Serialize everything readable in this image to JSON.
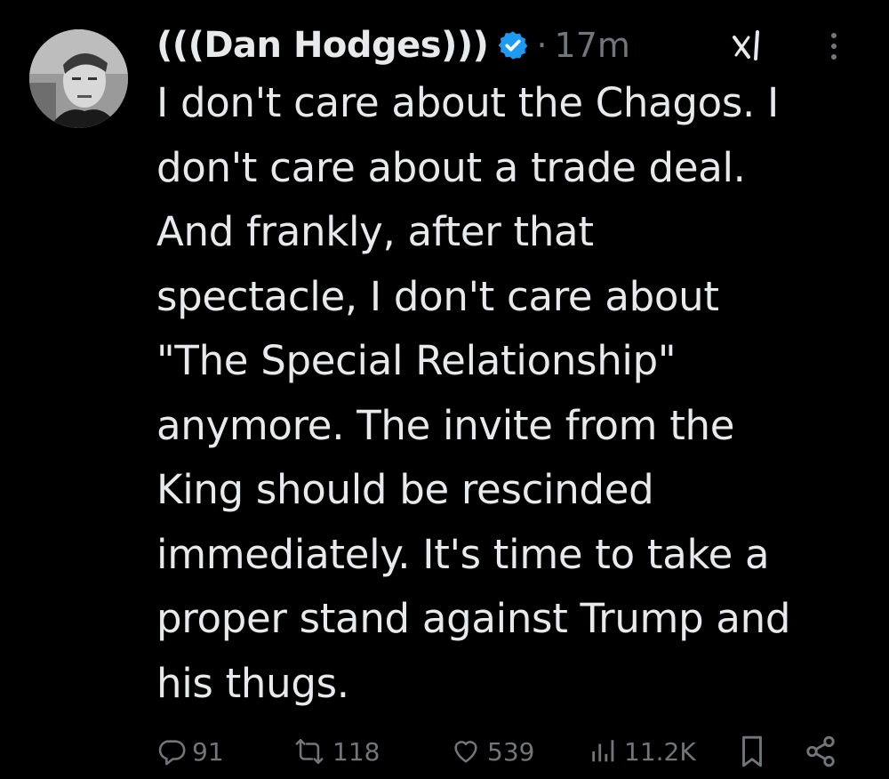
{
  "tweet": {
    "author_name": "(((Dan Hodges)))",
    "verified": true,
    "separator": "·",
    "time": "17m",
    "text": "I don't care about the Chagos. I\ndon't care about a trade deal.\nAnd frankly, after that\nspectacle, I don't care about\n\"The Special Relationship\"\nanymore. The invite from the\nKing should be rescinded\nimmediately. It's time to take a\nproper stand against Trump and\nhis thugs."
  },
  "actions": {
    "replies": "91",
    "retweets": "118",
    "likes": "539",
    "views": "11.2K"
  },
  "icons": {
    "avatar": "avatar-photo",
    "verified": "verified-badge-icon",
    "grok": "grok-icon",
    "more": "more-options-icon",
    "reply": "reply-icon",
    "retweet": "retweet-icon",
    "like": "heart-icon",
    "views": "views-bar-chart-icon",
    "bookmark": "bookmark-icon",
    "share": "share-icon"
  },
  "colors": {
    "background": "#000000",
    "text": "#e7e9ea",
    "muted": "#71767b",
    "verified": "#1d9bf0"
  }
}
